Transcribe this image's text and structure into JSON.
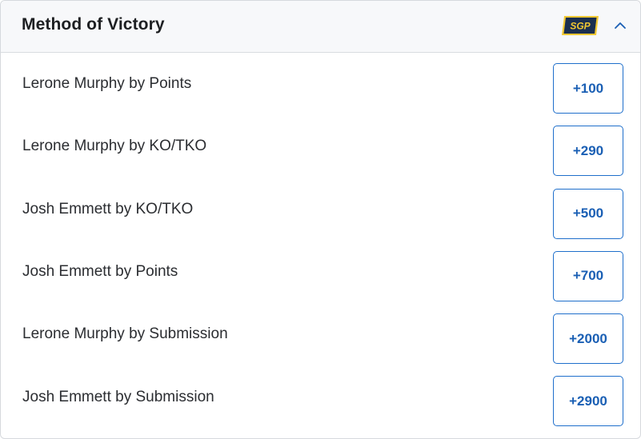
{
  "market": {
    "title": "Method of Victory",
    "badge": "SGP",
    "badge_colors": {
      "fill": "#1b2f4f",
      "accent": "#f2c832"
    },
    "collapse_icon": "chevron-up-icon"
  },
  "colors": {
    "odds_text": "#1a5fb4",
    "odds_border": "#1f6fcb",
    "header_bg": "#f7f8fa"
  },
  "selections": [
    {
      "label": "Lerone Murphy by Points",
      "odds": "+100"
    },
    {
      "label": "Lerone Murphy by KO/TKO",
      "odds": "+290"
    },
    {
      "label": "Josh Emmett by KO/TKO",
      "odds": "+500"
    },
    {
      "label": "Josh Emmett by Points",
      "odds": "+700"
    },
    {
      "label": "Lerone Murphy by Submission",
      "odds": "+2000"
    },
    {
      "label": "Josh Emmett by Submission",
      "odds": "+2900"
    }
  ]
}
